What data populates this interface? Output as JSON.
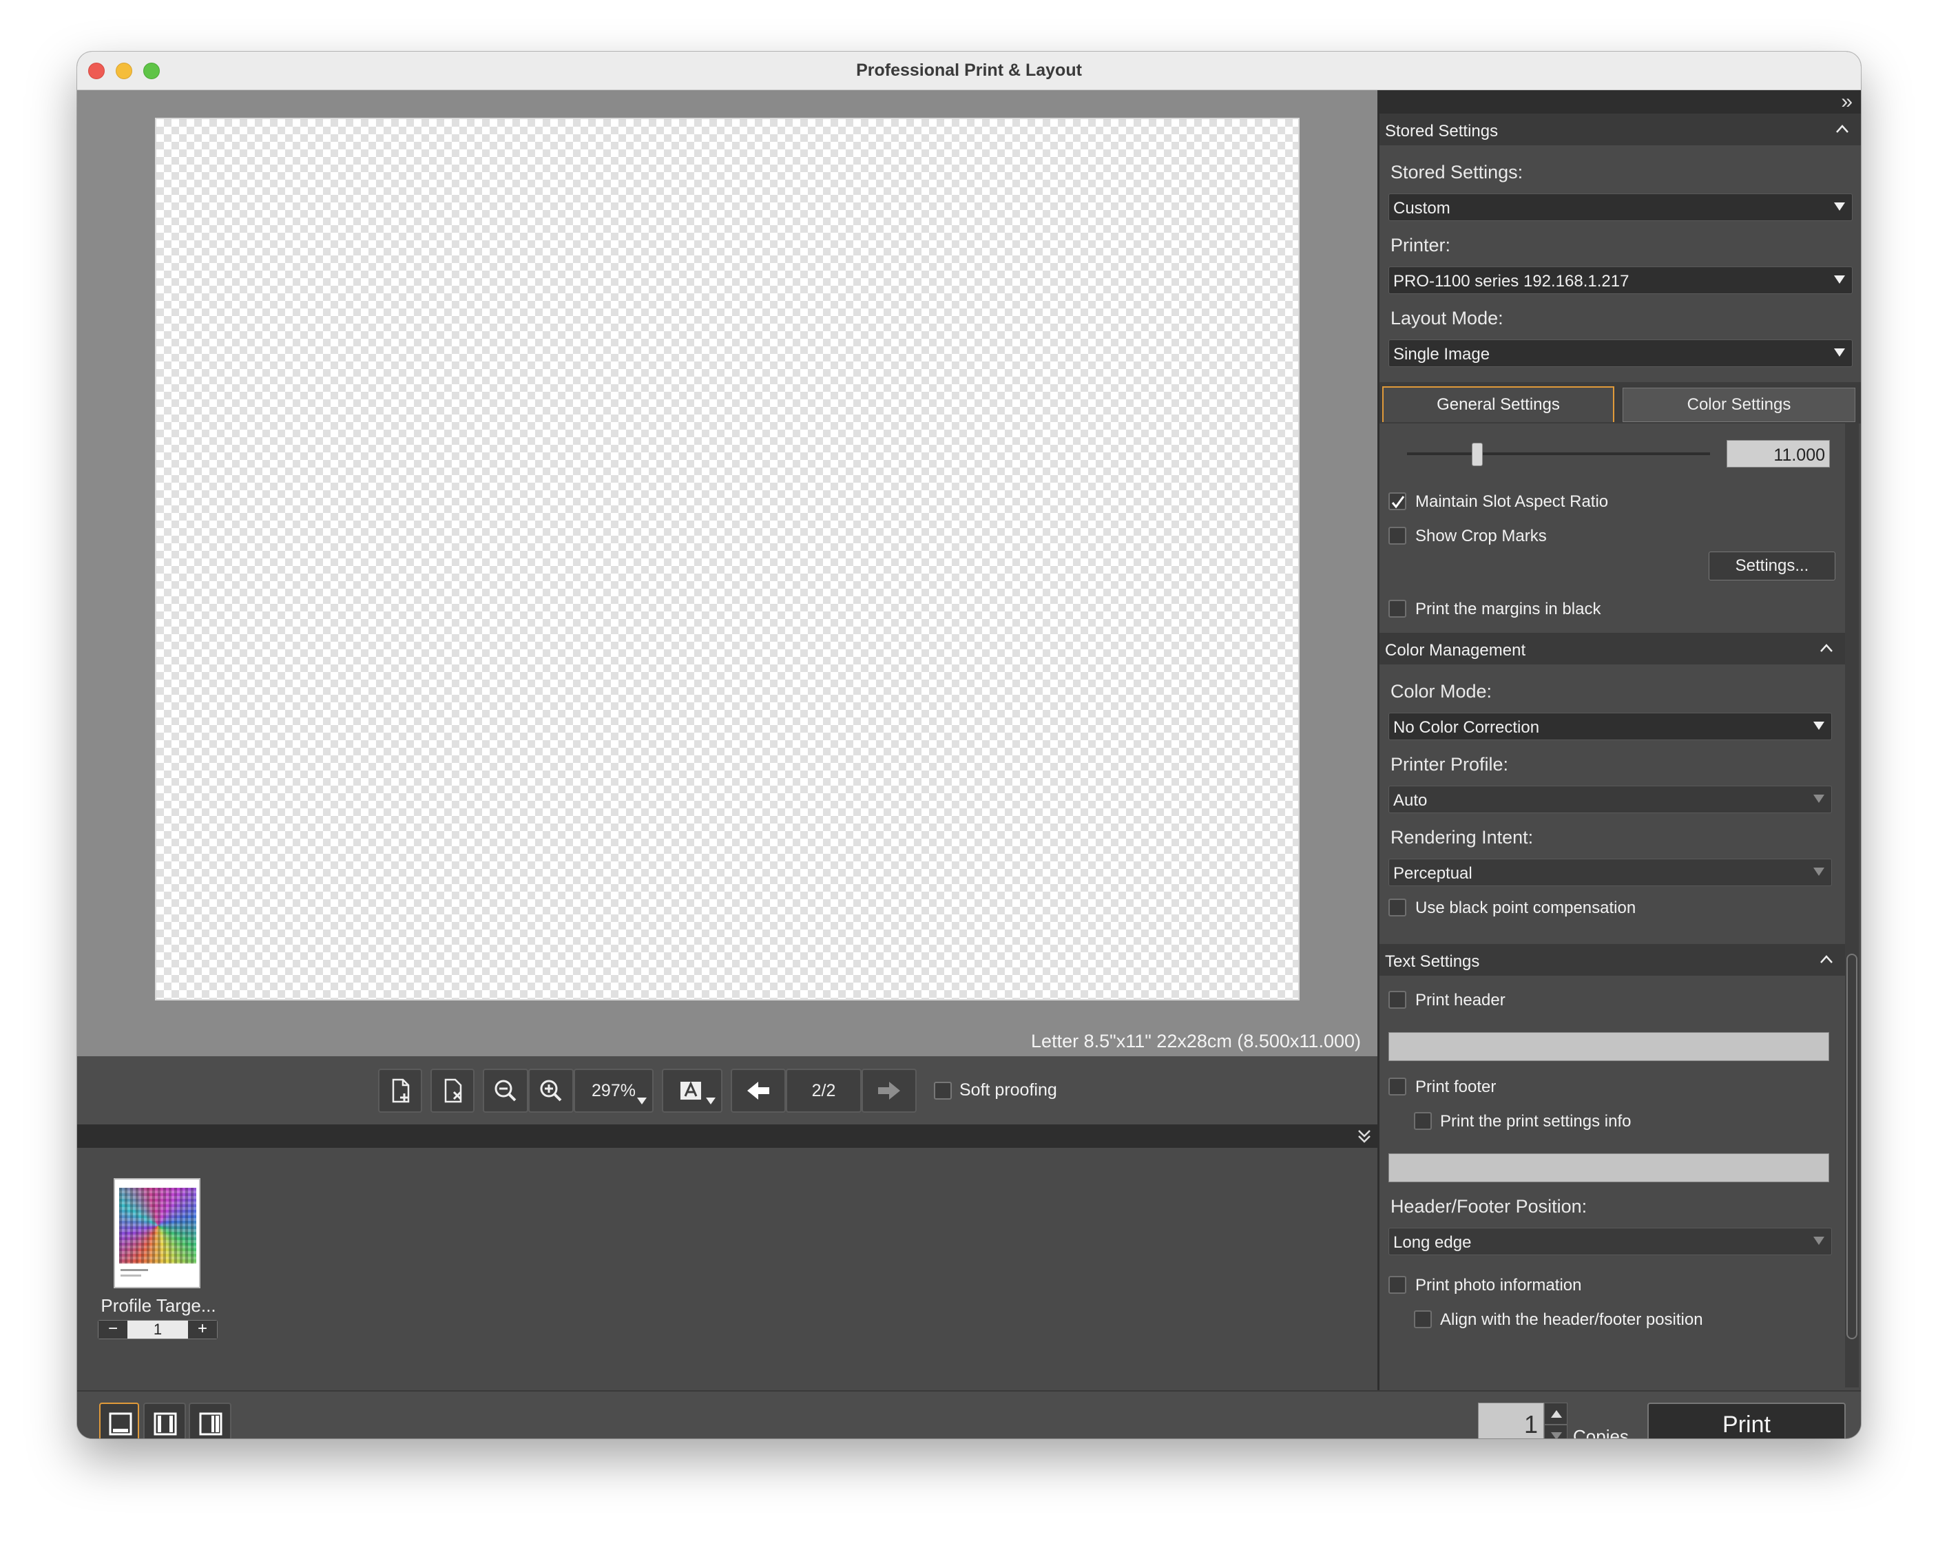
{
  "window": {
    "title": "Professional Print & Layout"
  },
  "preview": {
    "paper_info": "Letter 8.5\"x11\" 22x28cm (8.500x11.000)"
  },
  "toolbar": {
    "zoom": "297%",
    "page": "2/2",
    "soft_proofing_label": "Soft proofing",
    "soft_proofing_checked": false
  },
  "filmstrip": {
    "thumbnail_label": "Profile Targe...",
    "count": "1",
    "minus": "−",
    "plus": "+"
  },
  "panel": {
    "collapse_glyph": "»",
    "stored": {
      "section_title": "Stored Settings",
      "stored_label": "Stored Settings:",
      "stored_value": "Custom",
      "printer_label": "Printer:",
      "printer_value": "PRO-1100 series 192.168.1.217",
      "layout_label": "Layout Mode:",
      "layout_value": "Single Image"
    },
    "tabs": [
      "General Settings",
      "Color Settings"
    ],
    "general": {
      "slider_value": "11.000",
      "maintain_aspect": "Maintain Slot Aspect Ratio",
      "show_crop": "Show Crop Marks",
      "settings_button": "Settings...",
      "margins_black": "Print the margins in black"
    },
    "color": {
      "section_title": "Color Management",
      "mode_label": "Color Mode:",
      "mode_value": "No Color Correction",
      "profile_label": "Printer Profile:",
      "profile_value": "Auto",
      "intent_label": "Rendering Intent:",
      "intent_value": "Perceptual",
      "bpc": "Use black point compensation"
    },
    "text": {
      "section_title": "Text Settings",
      "print_header": "Print header",
      "print_footer": "Print footer",
      "print_settings_info": "Print the print settings info",
      "position_label": "Header/Footer Position:",
      "position_value": "Long edge",
      "photo_info": "Print photo information",
      "align": "Align with the header/footer position"
    }
  },
  "bottom": {
    "copies_value": "1",
    "copies_label": "Copies",
    "print_button": "Print"
  }
}
